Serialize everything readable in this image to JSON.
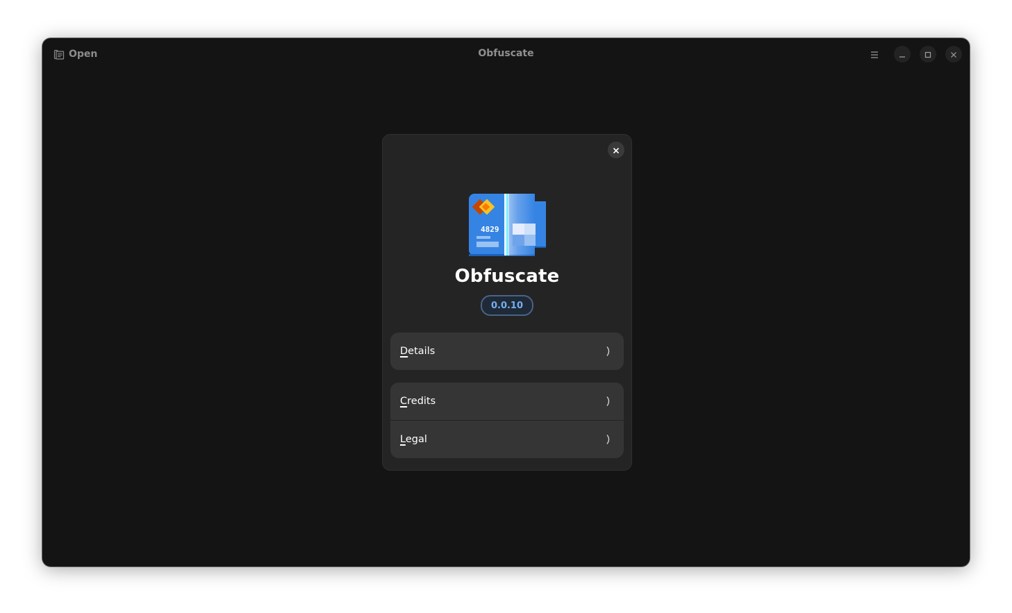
{
  "window": {
    "title": "Obfuscate",
    "open_button": {
      "label": "Open",
      "icon": "document-open-icon"
    },
    "controls": {
      "menu": "main-menu-icon",
      "minimize": "minimize-icon",
      "maximize": "maximize-icon",
      "close": "close-icon"
    }
  },
  "about_dialog": {
    "app_name": "Obfuscate",
    "version": "0.0.10",
    "icon_card_number": "4829",
    "close_icon": "close-icon",
    "rows": [
      {
        "mnemonic": "D",
        "rest": "etails",
        "label": "Details"
      },
      {
        "mnemonic": "C",
        "rest": "redits",
        "label": "Credits"
      },
      {
        "mnemonic": "L",
        "rest": "egal",
        "label": "Legal"
      }
    ]
  }
}
